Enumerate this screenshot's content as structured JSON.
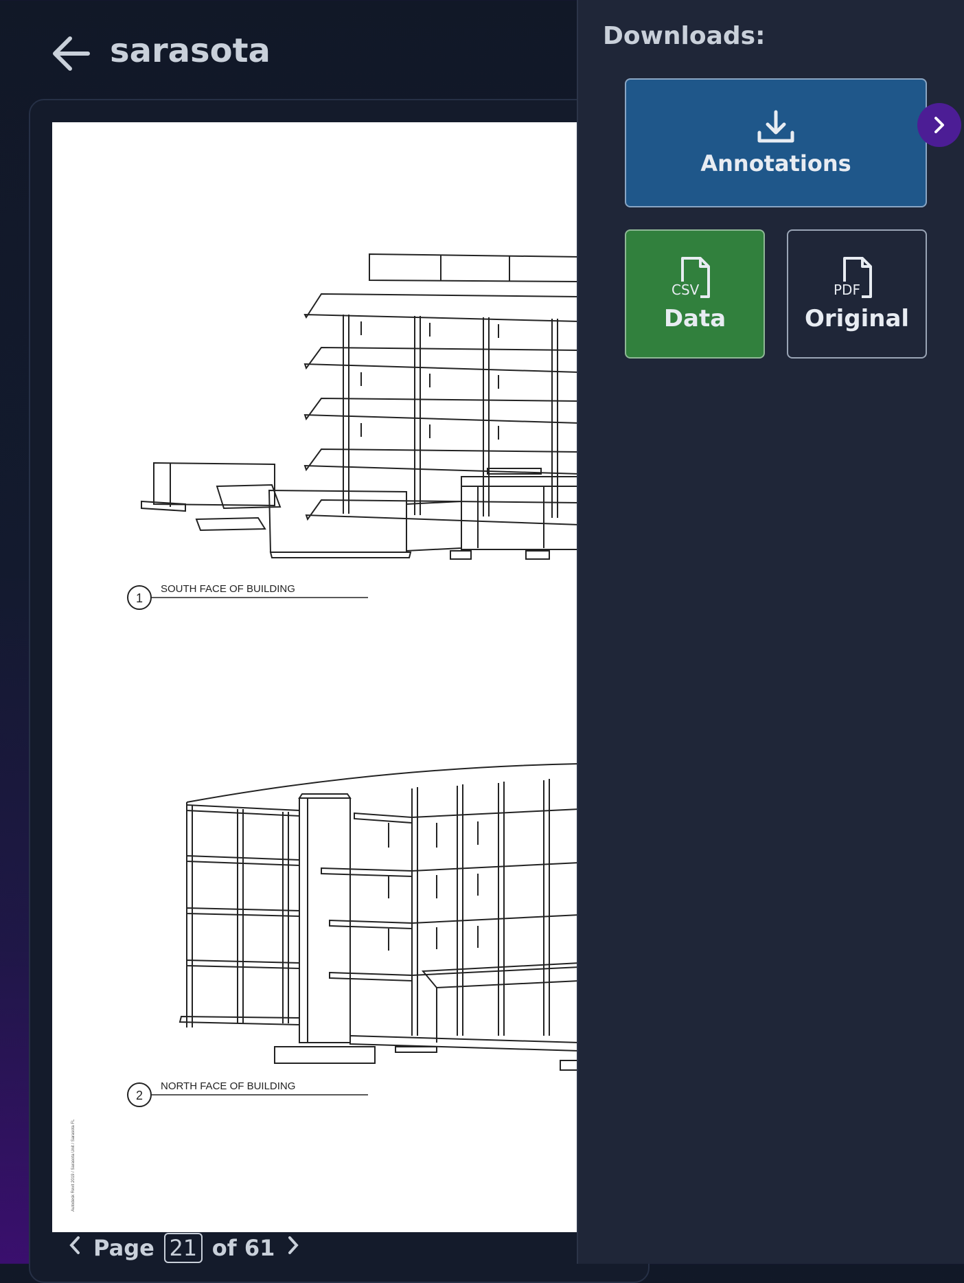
{
  "header": {
    "title": "sarasota",
    "back_icon": "arrow-left-icon"
  },
  "document": {
    "drawings": [
      {
        "number": "1",
        "caption": "SOUTH FACE OF BUILDING"
      },
      {
        "number": "2",
        "caption": "NORTH FACE OF BUILDING"
      }
    ],
    "margin_text": "Autodesk Revit 2019 / Sarasota Unit / Sarasota FL"
  },
  "pager": {
    "page_label": "Page",
    "current_page": "21",
    "of_label": "of 61",
    "prev_icon": "chevron-left-icon",
    "next_icon": "chevron-right-icon"
  },
  "downloads": {
    "title": "Downloads:",
    "annotations_label": "Annotations",
    "data_label": "Data",
    "data_icon_tag": "CSV",
    "original_label": "Original",
    "original_icon_tag": "PDF",
    "colors": {
      "annotations": "#1f578a",
      "data": "#31803d",
      "collapse": "#4c1d95"
    }
  }
}
